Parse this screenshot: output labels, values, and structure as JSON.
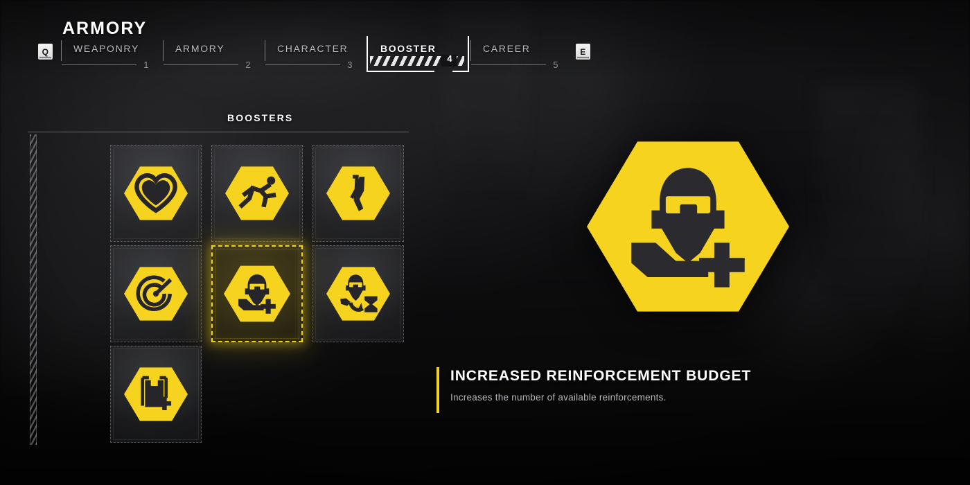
{
  "screen": {
    "title": "ARMORY",
    "accent_color": "#f2d21e",
    "text_color": "#ffffff",
    "muted_text_color": "#b9bcc1",
    "background_color": "#0a0a0a"
  },
  "keyhints": {
    "prev_key": "Q",
    "next_key": "E"
  },
  "tabs": [
    {
      "label": "WEAPONRY",
      "number": "1",
      "active": false
    },
    {
      "label": "ARMORY",
      "number": "2",
      "active": false
    },
    {
      "label": "CHARACTER",
      "number": "3",
      "active": false
    },
    {
      "label": "BOOSTER",
      "number": "4",
      "active": true
    },
    {
      "label": "CAREER",
      "number": "5",
      "active": false
    }
  ],
  "panel": {
    "heading": "BOOSTERS"
  },
  "boosters": [
    {
      "slot": 1,
      "icon": "heart-icon",
      "selected": false
    },
    {
      "slot": 2,
      "icon": "runner-icon",
      "selected": false
    },
    {
      "slot": 3,
      "icon": "leg-limb-icon",
      "selected": false
    },
    {
      "slot": 4,
      "icon": "radar-icon",
      "selected": false
    },
    {
      "slot": 5,
      "icon": "reinforcement-plus-icon",
      "selected": true
    },
    {
      "slot": 6,
      "icon": "reinforcement-timer-icon",
      "selected": false
    },
    {
      "slot": 7,
      "icon": "supply-crate-plus-icon",
      "selected": false
    }
  ],
  "preview": {
    "icon": "reinforcement-plus-icon",
    "title": "INCREASED REINFORCEMENT BUDGET",
    "description": "Increases the number of available reinforcements."
  }
}
